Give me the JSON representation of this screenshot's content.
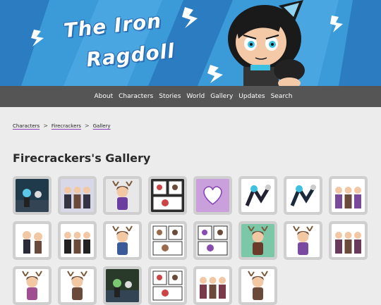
{
  "header": {
    "logo_line1": "The Iron",
    "logo_line2": "Ragdoll"
  },
  "nav": {
    "items": [
      "About",
      "Characters",
      "Stories",
      "World",
      "Gallery",
      "Updates",
      "Search"
    ]
  },
  "breadcrumb": {
    "items": [
      "Characters",
      "Firecrackers",
      "Gallery"
    ],
    "separator": ">"
  },
  "page": {
    "title": "Firecrackers's Gallery"
  },
  "gallery": {
    "thumbnails": [
      {
        "kind": "scene",
        "bg": "#1f3a4a",
        "fig": "#5bc8e8"
      },
      {
        "kind": "group",
        "bg": "#d8d8e8",
        "fig": "#333344"
      },
      {
        "kind": "antler",
        "bg": "#e8e8e8",
        "fig": "#6a3fa0"
      },
      {
        "kind": "comic",
        "bg": "#2a2a2a",
        "fig": "#cc4444"
      },
      {
        "kind": "heart",
        "bg": "#c9a0dc",
        "fig": "#ffffff"
      },
      {
        "kind": "fight",
        "bg": "#ffffff",
        "fig": "#222233"
      },
      {
        "kind": "fight",
        "bg": "#ffffff",
        "fig": "#1a2a3a"
      },
      {
        "kind": "group",
        "bg": "#ffffff",
        "fig": "#7a4a9a"
      },
      {
        "kind": "pair",
        "bg": "#ffffff",
        "fig": "#2a2a3a"
      },
      {
        "kind": "group",
        "bg": "#ffffff",
        "fig": "#222222"
      },
      {
        "kind": "antler",
        "bg": "#ffffff",
        "fig": "#3a5a9a"
      },
      {
        "kind": "comic",
        "bg": "#ffffff",
        "fig": "#9a6a4a"
      },
      {
        "kind": "comic",
        "bg": "#e8e8e8",
        "fig": "#8a4ab0"
      },
      {
        "kind": "antler",
        "bg": "#7ac8a8",
        "fig": "#6a3a2a"
      },
      {
        "kind": "antler",
        "bg": "#ffffff",
        "fig": "#7a4aa0"
      },
      {
        "kind": "group",
        "bg": "#ffffff",
        "fig": "#6a3a5a"
      },
      {
        "kind": "antler",
        "bg": "#ffffff",
        "fig": "#a05090"
      },
      {
        "kind": "antler",
        "bg": "#ffffff",
        "fig": "#6a4a3a"
      },
      {
        "kind": "scene",
        "bg": "#2a3a2a",
        "fig": "#7ac870"
      },
      {
        "kind": "comic",
        "bg": "#ffffff",
        "fig": "#cc4444"
      },
      {
        "kind": "group",
        "bg": "#ffffff",
        "fig": "#7a3a4a"
      },
      {
        "kind": "antler",
        "bg": "#ffffff",
        "fig": "#6a4a3a"
      }
    ]
  },
  "colors": {
    "banner_blue": "#2f8fd0",
    "navbar": "#555555",
    "accent_purple": "#8a3fb8",
    "page_bg": "#ececec"
  }
}
